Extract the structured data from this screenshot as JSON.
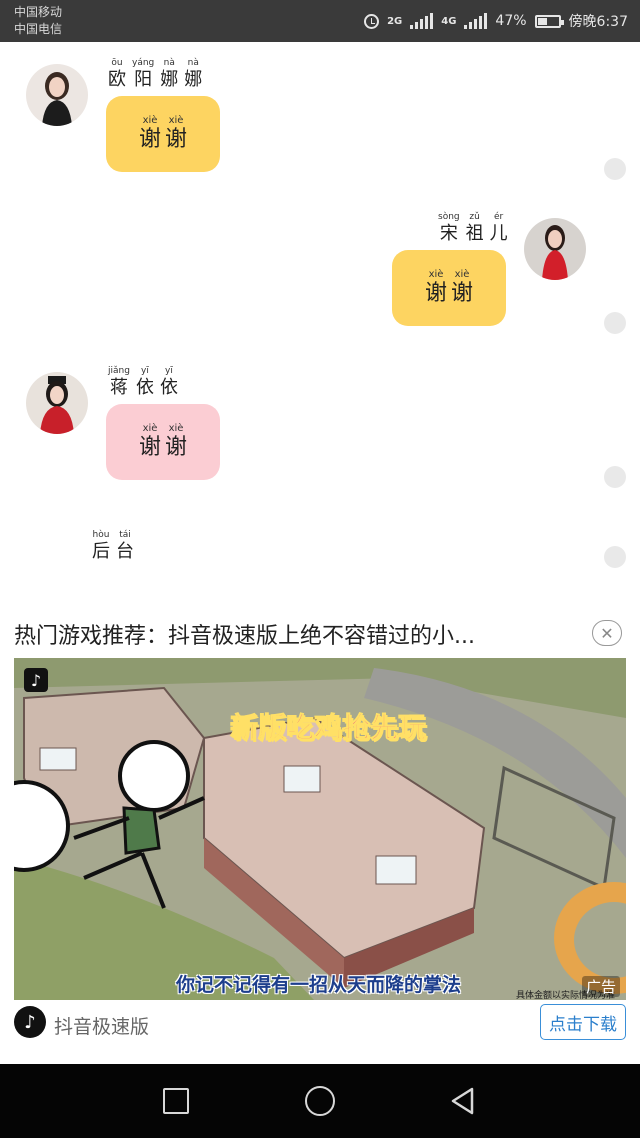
{
  "status_bar": {
    "carrier_1": "中国移动",
    "carrier_2": "中国电信",
    "net_1": "2G",
    "net_2": "4G",
    "battery": "47%",
    "time": "傍晚6:37",
    "battery_level": 0.47
  },
  "chat": [
    {
      "side": "left",
      "name": [
        {
          "py": "ōu",
          "hz": "欧"
        },
        {
          "py": "yáng",
          "hz": "阳"
        },
        {
          "py": "nà",
          "hz": "娜"
        },
        {
          "py": "nà",
          "hz": "娜"
        }
      ],
      "text": [
        {
          "py": "xiè",
          "hz": "谢"
        },
        {
          "py": "xiè",
          "hz": "谢"
        }
      ],
      "bubble_color": "#fdd461",
      "avatar_icon": "woman-black-dress-avatar"
    },
    {
      "side": "right",
      "name": [
        {
          "py": "sòng",
          "hz": "宋"
        },
        {
          "py": "zǔ",
          "hz": "祖"
        },
        {
          "py": "ér",
          "hz": "儿"
        }
      ],
      "text": [
        {
          "py": "xiè",
          "hz": "谢"
        },
        {
          "py": "xiè",
          "hz": "谢"
        }
      ],
      "bubble_color": "#fdd461",
      "avatar_icon": "woman-red-dress-avatar"
    },
    {
      "side": "left",
      "name": [
        {
          "py": "jiǎng",
          "hz": "蒋"
        },
        {
          "py": "yī",
          "hz": "依"
        },
        {
          "py": "yī",
          "hz": "依"
        }
      ],
      "text": [
        {
          "py": "xiè",
          "hz": "谢"
        },
        {
          "py": "xiè",
          "hz": "谢"
        }
      ],
      "bubble_color": "#fbcdd3",
      "avatar_icon": "woman-red-costume-avatar"
    }
  ],
  "backstage": [
    {
      "py": "hòu",
      "hz": "后"
    },
    {
      "py": "tái",
      "hz": "台"
    }
  ],
  "ad": {
    "title": "热门游戏推荐：抖音极速版上绝不容错过的小...",
    "close_icon": "close-icon",
    "image_headline": "新版吃鸡抢先玩",
    "image_caption": "你记不记得有一招从天而降的掌法",
    "image_disclaimer": "具体金额以实际情况为准",
    "ad_label": "广告",
    "brand_name": "抖音极速版",
    "download_label": "点击下载"
  },
  "nav": {
    "recent_icon": "square-icon",
    "home_icon": "circle-icon",
    "back_icon": "triangle-back-icon"
  }
}
